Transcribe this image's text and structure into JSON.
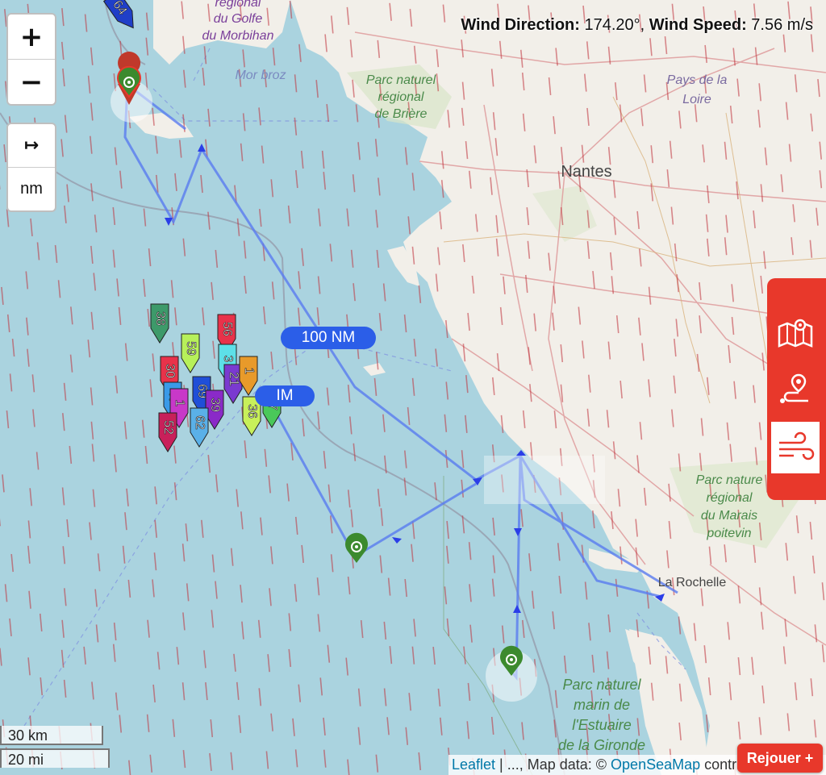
{
  "map": {
    "place_labels": {
      "golfe_top": "régional",
      "golfe1": "du Golfe",
      "golfe2": "du Morbihan",
      "mor_broz": "Mor broz",
      "briere1": "Parc naturel",
      "briere2": "régional",
      "briere3": "de Brière",
      "pays_loire1": "Pays de la",
      "pays_loire2": "Loire",
      "nantes": "Nantes",
      "marais1": "Parc nature",
      "marais2": "régional",
      "marais3": "du Marais",
      "marais4": "poitevin",
      "la_rochelle": "La Rochelle",
      "gironde1": "Parc naturel",
      "gironde2": "marin de",
      "gironde3": "l'Estuaire",
      "gironde4": "de la Gironde"
    },
    "distance_labels": [
      "100 NM",
      "IM"
    ],
    "boats": [
      "64",
      "38",
      "59",
      "56",
      "30",
      "3",
      "21",
      "1",
      "47",
      "1",
      "69",
      "39",
      "36",
      "27",
      "62",
      "52"
    ],
    "colors": {
      "sea": "#aad3df",
      "land": "#f2efe9",
      "route": "#5a7cf0",
      "panel": "#e8382b",
      "waypoint": "#3c8a2e",
      "wind_arrow": "#c0303a"
    }
  },
  "controls": {
    "zoom_in": "+",
    "zoom_out": "−",
    "unit_icon": "↦",
    "unit_label": "nm"
  },
  "wind": {
    "dir_label": "Wind Direction:",
    "dir_value": "174.20°,",
    "speed_label": "Wind Speed:",
    "speed_value": "7.56 m/s"
  },
  "side_panel": {
    "icons": [
      "map-route-icon",
      "route-pin-icon",
      "wind-icon"
    ],
    "active": "wind-icon"
  },
  "scale": {
    "km": "30 km",
    "mi": "20 mi"
  },
  "attribution": {
    "leaflet": "Leaflet",
    "sep": " | ..., Map data: © ",
    "osm": "OpenSeaMap",
    "rest": " contributors"
  },
  "replay_button": "Rejouer +"
}
